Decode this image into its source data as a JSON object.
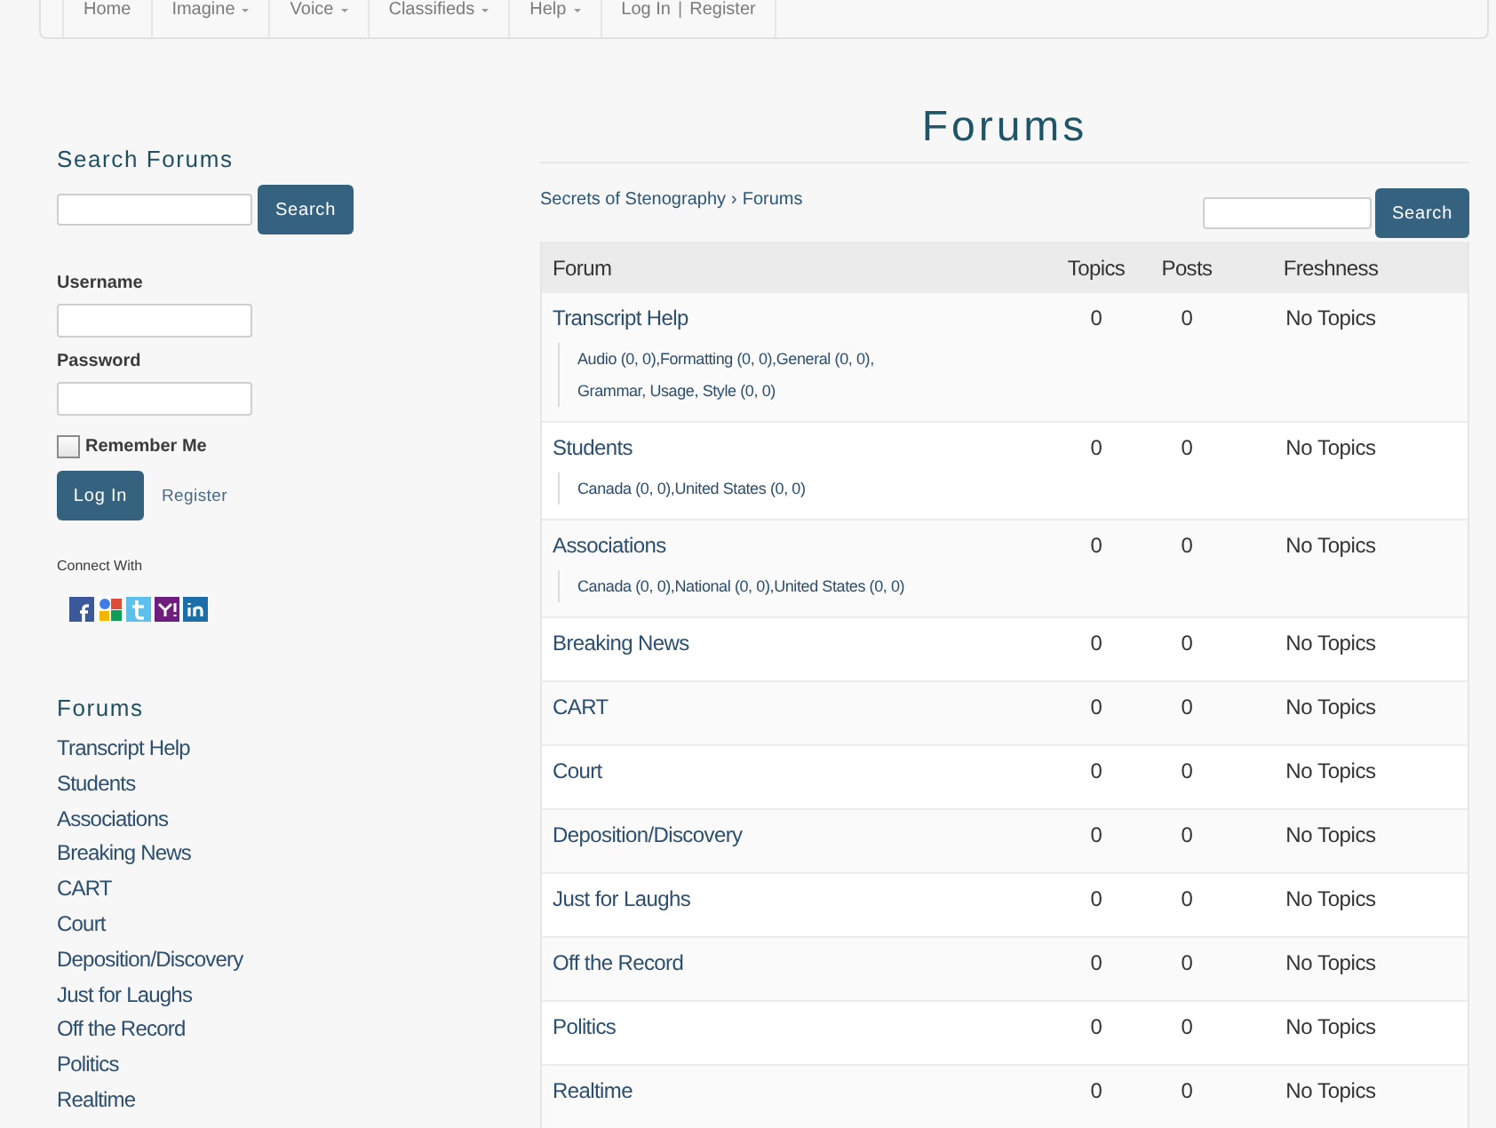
{
  "nav": {
    "items": [
      {
        "label": "Home",
        "dropdown": false
      },
      {
        "label": "Imagine",
        "dropdown": true
      },
      {
        "label": "Voice",
        "dropdown": true
      },
      {
        "label": "Classifieds",
        "dropdown": true
      },
      {
        "label": "Help",
        "dropdown": true
      }
    ],
    "account": {
      "login": "Log In",
      "separator": "|",
      "register": "Register"
    }
  },
  "sidebar": {
    "search": {
      "title": "Search Forums",
      "button": "Search"
    },
    "login": {
      "username_label": "Username",
      "password_label": "Password",
      "remember_me": {
        "label": "Remember Me",
        "checked": false
      },
      "login_button": "Log In",
      "register_link": "Register"
    },
    "connect": {
      "title": "Connect With"
    },
    "forums": {
      "title": "Forums",
      "links": [
        "Transcript Help",
        "Students",
        "Associations",
        "Breaking News",
        "CART",
        "Court",
        "Deposition/Discovery",
        "Just for Laughs",
        "Off the Record",
        "Politics",
        "Realtime"
      ]
    }
  },
  "main": {
    "title": "Forums",
    "breadcrumb": {
      "items": [
        "Secrets of Stenography",
        "Forums"
      ],
      "separator": "›"
    },
    "search": {
      "button": "Search"
    },
    "table": {
      "columns": [
        "Forum",
        "Topics",
        "Posts",
        "Freshness"
      ],
      "rows": [
        {
          "forum": "Transcript Help",
          "topics": "0",
          "posts": "0",
          "freshness": "No Topics",
          "subforums": [
            "Audio (0, 0),",
            "Formatting (0, 0),",
            "General (0, 0),",
            "Grammar, Usage, Style (0, 0)"
          ]
        },
        {
          "forum": "Students",
          "topics": "0",
          "posts": "0",
          "freshness": "No Topics",
          "subforums": [
            "Canada (0, 0),",
            "United States (0, 0)"
          ]
        },
        {
          "forum": "Associations",
          "topics": "0",
          "posts": "0",
          "freshness": "No Topics",
          "subforums": [
            "Canada (0, 0),",
            "National (0, 0),",
            "United States (0, 0)"
          ]
        },
        {
          "forum": "Breaking News",
          "topics": "0",
          "posts": "0",
          "freshness": "No Topics"
        },
        {
          "forum": "CART",
          "topics": "0",
          "posts": "0",
          "freshness": "No Topics"
        },
        {
          "forum": "Court",
          "topics": "0",
          "posts": "0",
          "freshness": "No Topics"
        },
        {
          "forum": "Deposition/Discovery",
          "topics": "0",
          "posts": "0",
          "freshness": "No Topics"
        },
        {
          "forum": "Just for Laughs",
          "topics": "0",
          "posts": "0",
          "freshness": "No Topics"
        },
        {
          "forum": "Off the Record",
          "topics": "0",
          "posts": "0",
          "freshness": "No Topics"
        },
        {
          "forum": "Politics",
          "topics": "0",
          "posts": "0",
          "freshness": "No Topics"
        },
        {
          "forum": "Realtime",
          "topics": "0",
          "posts": "0",
          "freshness": "No Topics"
        }
      ]
    }
  }
}
